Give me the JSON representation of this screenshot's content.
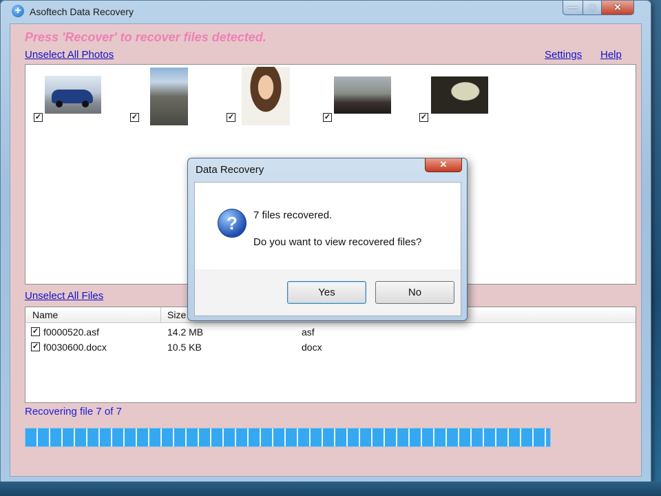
{
  "window": {
    "title": "Asoftech Data Recovery",
    "controls": {
      "minimize": "—",
      "maximize": "□",
      "close": "✕"
    }
  },
  "instruction": "Press 'Recover' to recover files detected.",
  "links": {
    "unselect_photos": "Unselect All Photos",
    "settings": "Settings",
    "help": "Help",
    "unselect_files": "Unselect All Files"
  },
  "photos": [
    {
      "name": "car",
      "checked": true
    },
    {
      "name": "mountain",
      "checked": true
    },
    {
      "name": "portrait",
      "checked": true
    },
    {
      "name": "group",
      "checked": true
    },
    {
      "name": "presentation",
      "checked": true
    }
  ],
  "files": {
    "columns": [
      "Name",
      "Size"
    ],
    "rows": [
      {
        "name": "f0000520.asf",
        "size": "14.2 MB",
        "type": "asf",
        "checked": true
      },
      {
        "name": "f0030600.docx",
        "size": "10.5 KB",
        "type": "docx",
        "checked": true
      }
    ]
  },
  "status": "Recovering file 7 of 7",
  "progress_fraction": 0.86,
  "dialog": {
    "title": "Data Recovery",
    "close": "✕",
    "icon": "question-icon",
    "message1": "7 files recovered.",
    "message2": "Do you want to view recovered files?",
    "yes": "Yes",
    "no": "No"
  },
  "colors": {
    "client_bg": "#e6c8cb",
    "instruction": "#f07fb4",
    "link": "#1212c8",
    "status": "#1c1cd6",
    "progress": "#35a8f2"
  }
}
